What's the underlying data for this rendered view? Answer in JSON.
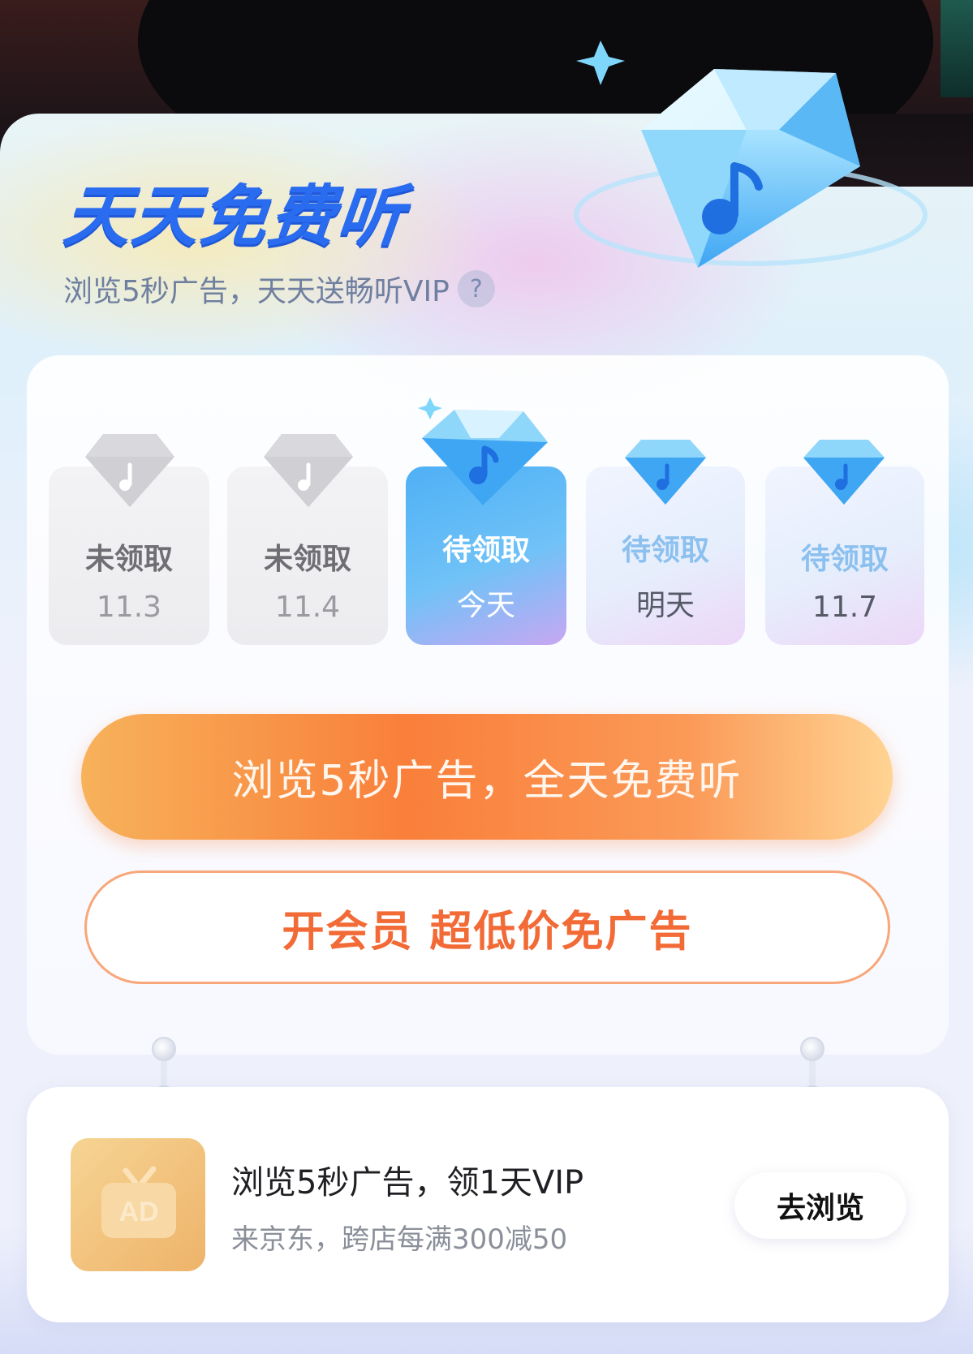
{
  "header": {
    "title": "天天免费听",
    "subtitle": "浏览5秒广告，天天送畅听VIP",
    "help_icon": "?"
  },
  "days": [
    {
      "status": "未领取",
      "date": "11.3",
      "state": "claimed"
    },
    {
      "status": "未领取",
      "date": "11.4",
      "state": "claimed"
    },
    {
      "status": "待领取",
      "date": "今天",
      "state": "today"
    },
    {
      "status": "待领取",
      "date": "明天",
      "state": "future"
    },
    {
      "status": "待领取",
      "date": "11.7",
      "state": "future"
    }
  ],
  "actions": {
    "watch_ad_label": "浏览5秒广告，全天免费听",
    "vip_label": "开会员 超低价免广告"
  },
  "ad": {
    "thumb_label": "AD",
    "title": "浏览5秒广告，领1天VIP",
    "subtitle": "来京东，跨店每满300减50",
    "button_label": "去浏览"
  },
  "colors": {
    "title_blue": "#2a6cf0",
    "orange": "#f97f3a",
    "vip_text": "#f26a36",
    "diamond_blue": "#57b6f5"
  },
  "icons": {
    "hero": "diamond-music-icon",
    "day_claimed": "gray-diamond-icon",
    "day_active": "blue-diamond-icon",
    "ad": "tv-ad-icon"
  }
}
